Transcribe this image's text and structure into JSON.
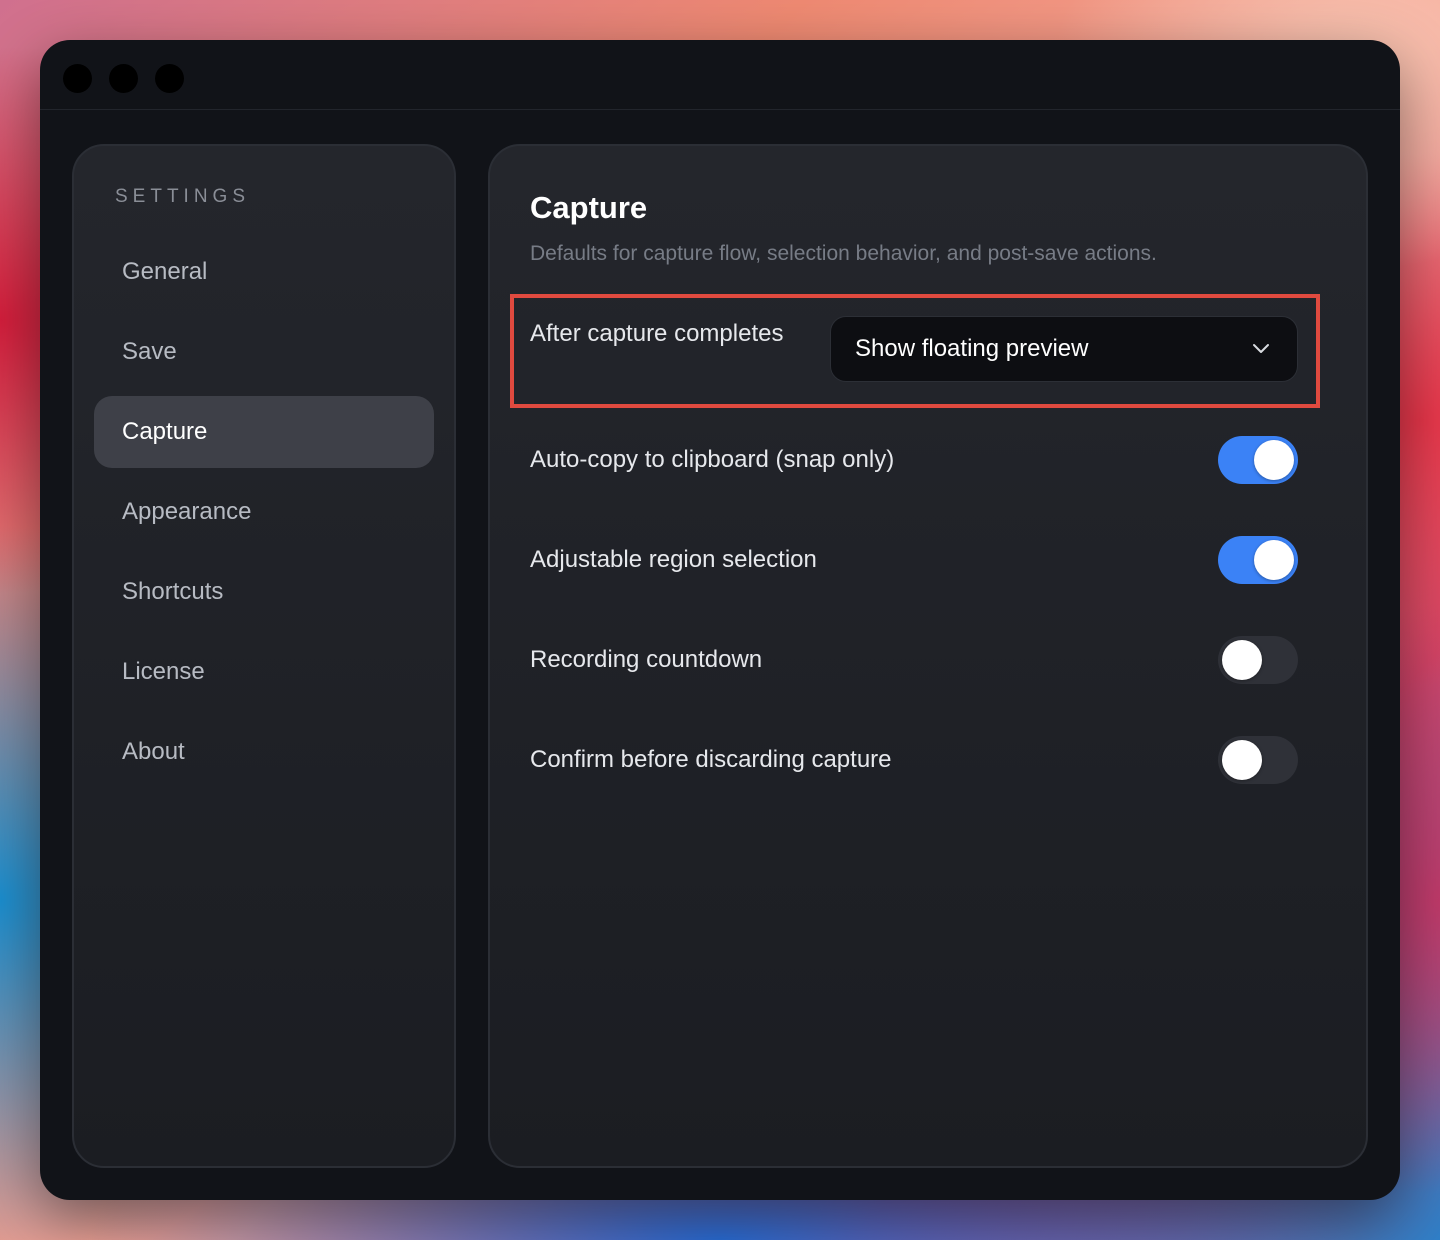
{
  "sidebar": {
    "heading": "SETTINGS",
    "items": [
      {
        "label": "General",
        "active": false
      },
      {
        "label": "Save",
        "active": false
      },
      {
        "label": "Capture",
        "active": true
      },
      {
        "label": "Appearance",
        "active": false
      },
      {
        "label": "Shortcuts",
        "active": false
      },
      {
        "label": "License",
        "active": false
      },
      {
        "label": "About",
        "active": false
      }
    ]
  },
  "main": {
    "title": "Capture",
    "subtitle": "Defaults for capture flow, selection behavior, and post-save actions.",
    "after_capture": {
      "label": "After capture completes",
      "selected": "Show floating preview",
      "highlight_color": "#e04a3f"
    },
    "toggles": [
      {
        "label": "Auto-copy to clipboard (snap only)",
        "on": true
      },
      {
        "label": "Adjustable region selection",
        "on": true
      },
      {
        "label": "Recording countdown",
        "on": false
      },
      {
        "label": "Confirm before discarding capture",
        "on": false
      }
    ]
  },
  "colors": {
    "accent": "#3b82f6",
    "window_bg": "#111318",
    "panel_bg": "#202228"
  }
}
